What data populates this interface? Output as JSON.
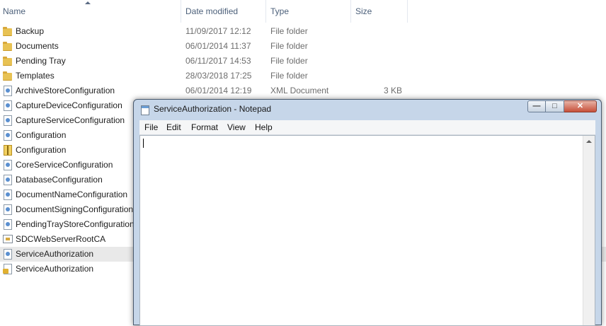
{
  "explorer": {
    "columns": {
      "name": "Name",
      "date": "Date modified",
      "type": "Type",
      "size": "Size"
    },
    "rows": [
      {
        "name": "Backup",
        "date": "11/09/2017 12:12",
        "type": "File folder",
        "size": "",
        "icon": "folder-icon"
      },
      {
        "name": "Documents",
        "date": "06/01/2014 11:37",
        "type": "File folder",
        "size": "",
        "icon": "folder-icon"
      },
      {
        "name": "Pending Tray",
        "date": "06/11/2017 14:53",
        "type": "File folder",
        "size": "",
        "icon": "folder-icon"
      },
      {
        "name": "Templates",
        "date": "28/03/2018 17:25",
        "type": "File folder",
        "size": "",
        "icon": "folder-icon"
      },
      {
        "name": "ArchiveStoreConfiguration",
        "date": "06/01/2014 12:19",
        "type": "XML Document",
        "size": "3 KB",
        "icon": "xml-doc-icon"
      },
      {
        "name": "CaptureDeviceConfiguration",
        "date": "",
        "type": "",
        "size": "",
        "icon": "xml-doc-icon"
      },
      {
        "name": "CaptureServiceConfiguration",
        "date": "",
        "type": "",
        "size": "",
        "icon": "xml-doc-icon"
      },
      {
        "name": "Configuration",
        "date": "",
        "type": "",
        "size": "",
        "icon": "xml-doc-icon"
      },
      {
        "name": "Configuration",
        "date": "",
        "type": "",
        "size": "",
        "icon": "zip-icon"
      },
      {
        "name": "CoreServiceConfiguration",
        "date": "",
        "type": "",
        "size": "",
        "icon": "xml-doc-icon"
      },
      {
        "name": "DatabaseConfiguration",
        "date": "",
        "type": "",
        "size": "",
        "icon": "xml-doc-icon"
      },
      {
        "name": "DocumentNameConfiguration",
        "date": "",
        "type": "",
        "size": "",
        "icon": "xml-doc-icon"
      },
      {
        "name": "DocumentSigningConfiguration",
        "date": "",
        "type": "",
        "size": "",
        "icon": "xml-doc-icon"
      },
      {
        "name": "PendingTrayStoreConfiguration",
        "date": "",
        "type": "",
        "size": "",
        "icon": "xml-doc-icon"
      },
      {
        "name": "SDCWebServerRootCA",
        "date": "",
        "type": "",
        "size": "",
        "icon": "certificate-icon"
      },
      {
        "name": "ServiceAuthorization",
        "date": "",
        "type": "",
        "size": "",
        "icon": "xml-doc-icon"
      },
      {
        "name": "ServiceAuthorization",
        "date": "",
        "type": "",
        "size": "",
        "icon": "locked-doc-icon"
      }
    ]
  },
  "notepad": {
    "title": "ServiceAuthorization - Notepad",
    "menu": [
      "File",
      "Edit",
      "Format",
      "View",
      "Help"
    ],
    "controls": {
      "minimize": "—",
      "maximize": "□",
      "close": "✕"
    },
    "content": ""
  }
}
